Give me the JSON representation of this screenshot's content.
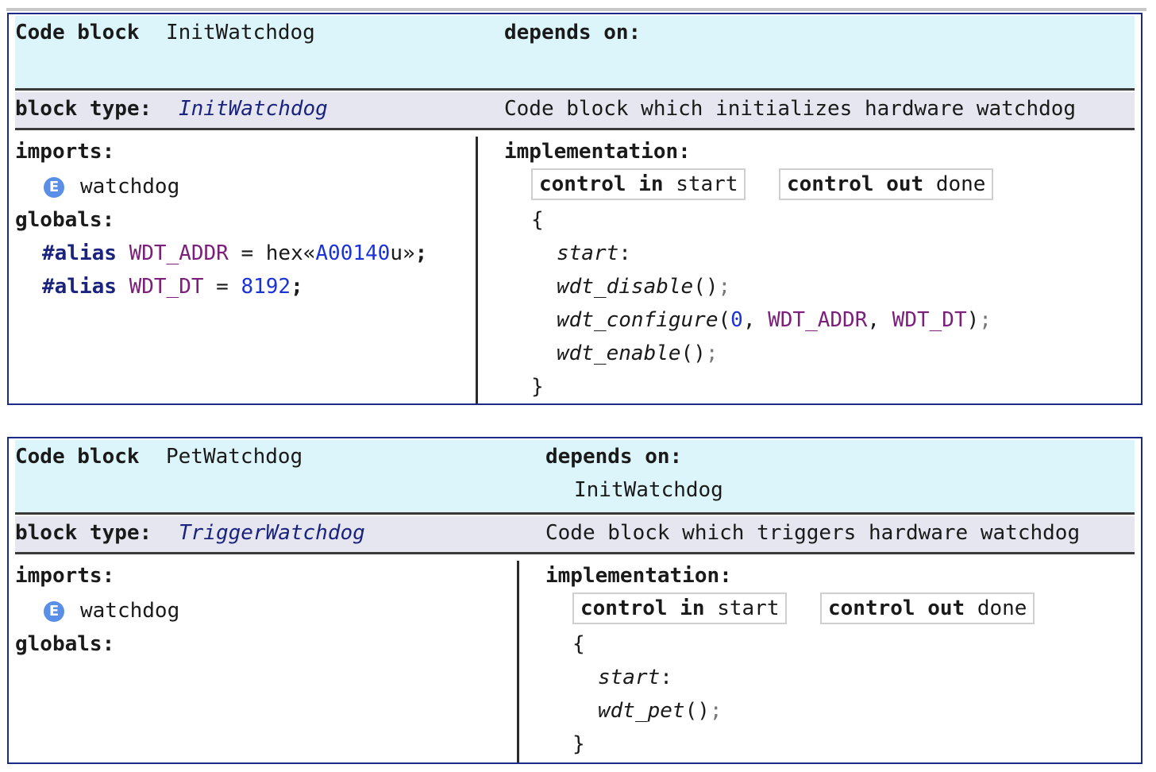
{
  "labels": {
    "code_block": "Code block",
    "depends_on": "depends on:",
    "block_type": "block type:",
    "imports": "imports:",
    "globals": "globals:",
    "implementation": "implementation:",
    "control_in": "control in",
    "control_out": "control out",
    "open_brace": "{",
    "close_brace": "}",
    "import_icon": "E"
  },
  "icons": {
    "import_icon_name": "enum-icon",
    "import_icon_color": "#5a8fe8"
  },
  "blocks": [
    {
      "name": "InitWatchdog",
      "depends_on": [],
      "block_type": "InitWatchdog",
      "description": "Code block which initializes hardware watchdog",
      "imports": [
        "watchdog"
      ],
      "globals": [
        {
          "keyword": "#alias",
          "name": "WDT_ADDR",
          "eq": "=",
          "value_prefix": "hex«",
          "value": "A00140",
          "value_suffix": "u»",
          "end": ";"
        },
        {
          "keyword": "#alias",
          "name": "WDT_DT",
          "eq": "=",
          "value": "8192",
          "end": ";"
        }
      ],
      "control_in": "start",
      "control_out": "done",
      "label": "start",
      "statements": [
        {
          "fn": "wdt_disable",
          "args": []
        },
        {
          "fn": "wdt_configure",
          "args": [
            "0",
            "WDT_ADDR",
            "WDT_DT"
          ]
        },
        {
          "fn": "wdt_enable",
          "args": []
        }
      ]
    },
    {
      "name": "PetWatchdog",
      "depends_on": [
        "InitWatchdog"
      ],
      "block_type": "TriggerWatchdog",
      "description": "Code block which triggers hardware watchdog",
      "imports": [
        "watchdog"
      ],
      "globals": [],
      "control_in": "start",
      "control_out": "done",
      "label": "start",
      "statements": [
        {
          "fn": "wdt_pet",
          "args": []
        }
      ]
    }
  ]
}
